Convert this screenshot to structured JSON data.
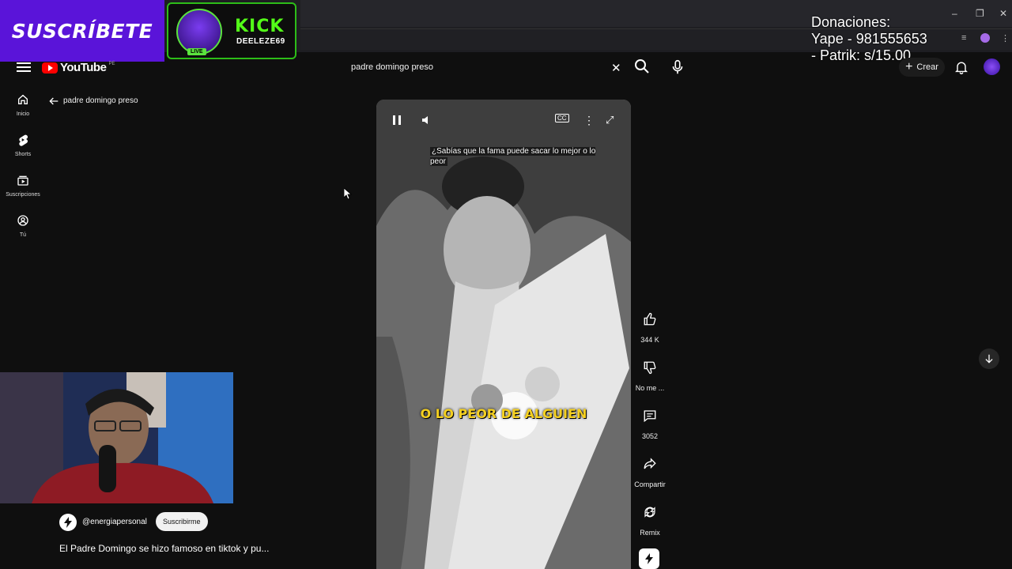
{
  "overlay": {
    "subscribe_text": "SUSCRÍBETE",
    "kick_brand": "KICK",
    "kick_user": "DEELEZE69",
    "live_badge": "LIVE",
    "donations_line1": "Donaciones:",
    "donations_line2": "Yape - 981555653",
    "donations_line3": "- Patrik: s/15.00"
  },
  "header": {
    "logo_text": "YouTube",
    "logo_country": "PE",
    "search_value": "padre domingo preso",
    "create_label": "Crear"
  },
  "guide": {
    "items": [
      {
        "label": "Inicio",
        "icon": "home-icon"
      },
      {
        "label": "Shorts",
        "icon": "shorts-icon"
      },
      {
        "label": "Suscripciones",
        "icon": "subscriptions-icon"
      },
      {
        "label": "Tú",
        "icon": "you-icon"
      }
    ]
  },
  "back_title": "padre domingo preso",
  "short": {
    "caption_top": "¿Sabías que la fama puede sacar lo mejor o lo peor",
    "caption_big": "O LO PEOR DE ALGUIEN",
    "channel": "@energiapersonal",
    "subscribe_label": "Suscribirme",
    "title": "El Padre Domingo se hizo famoso en tiktok y pu..."
  },
  "actions": {
    "like_count": "344 K",
    "dislike_label": "No me ...",
    "comments_count": "3052",
    "share_label": "Compartir",
    "remix_label": "Remix"
  },
  "colors": {
    "subscribe_bg": "#5a14d9",
    "kick_green": "#53fc18",
    "yt_red": "#ff0000",
    "caption_yellow": "#f5d020",
    "bg": "#0f0f0f"
  }
}
